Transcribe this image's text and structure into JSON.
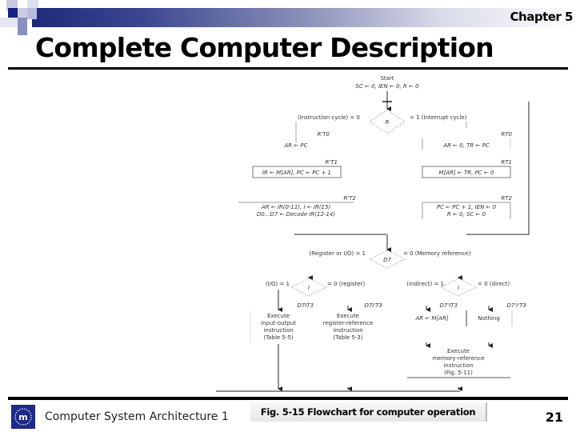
{
  "header": {
    "chapter": "Chapter 5",
    "title": "Complete Computer Description"
  },
  "footer": {
    "course": "Computer System Architecture 1",
    "caption": "Fig. 5-15  Flowchart for computer operation",
    "page_number": "21",
    "logo_icon": "university-logo-icon"
  },
  "flowchart": {
    "start": "Start",
    "init": "SC ← 0, IEN ← 0, R ← 0",
    "decision_R": {
      "label": "R",
      "left": "(Instruction cycle) = 0",
      "right": "= 1 (Interrupt cycle)"
    },
    "fetch": {
      "t0_cond": "R'T0",
      "t0_op": "AR ← PC",
      "t1_cond": "R'T1",
      "t1_op": "IR ← M[AR], PC ← PC + 1",
      "t2_cond": "R'T2",
      "t2_op_line1": "AR ← IR(0-11), I ← IR(15)",
      "t2_op_line2": "D0...D7 ← Decode IR(12-14)"
    },
    "interrupt": {
      "t0_cond": "RT0",
      "t0_op": "AR ← 0, TR ← PC",
      "t1_cond": "RT1",
      "t1_op": "M[AR] ← TR, PC ← 0",
      "t2_cond": "RT2",
      "t2_op_line1": "PC ← PC + 1, IEN ← 0",
      "t2_op_line2": "R ← 0, SC ← 0"
    },
    "decision_D7": {
      "label": "D7",
      "left": "(Register or I/O) = 1",
      "right": "= 0 (Memory reference)"
    },
    "decision_I_left": {
      "label": "I",
      "left": "(I/O) = 1",
      "right": "= 0 (register)"
    },
    "decision_I_right": {
      "label": "I",
      "left": "(indirect) = 1",
      "right": "= 0 (direct)"
    },
    "branches": {
      "io_cond": "D7IT3",
      "io_op": [
        "Execute",
        "input-output",
        "instruction",
        "(Table 5-5)"
      ],
      "reg_cond": "D7I'T3",
      "reg_op": [
        "Execute",
        "register-reference",
        "instruction",
        "(Table 5-3)"
      ],
      "ind_cond": "D7'IT3",
      "ind_op": "AR ← M[AR]",
      "dir_cond": "D7'I'T3",
      "dir_op": "Nothing",
      "mem_op": [
        "Execute",
        "memory-reference",
        "instruction",
        "(Fig. 5-11)"
      ]
    }
  }
}
